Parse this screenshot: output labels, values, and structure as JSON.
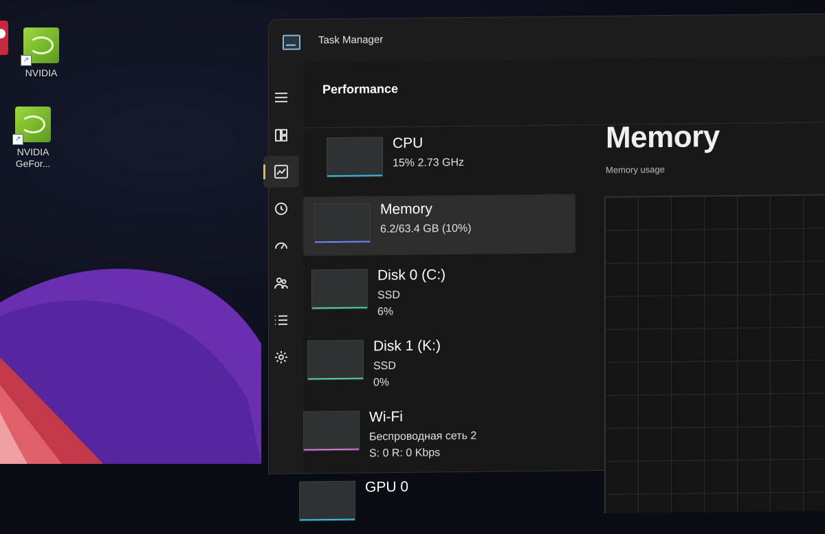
{
  "desktop": {
    "icons": [
      {
        "label": "NVIDIA"
      },
      {
        "label": "NVIDIA GeFor..."
      }
    ]
  },
  "window": {
    "title": "Task Manager",
    "page_title": "Performance",
    "active_nav": "performance"
  },
  "nav": [
    {
      "name": "hamburger-menu-icon"
    },
    {
      "name": "processes-icon"
    },
    {
      "name": "performance-icon"
    },
    {
      "name": "app-history-icon"
    },
    {
      "name": "startup-apps-icon"
    },
    {
      "name": "users-icon"
    },
    {
      "name": "details-icon"
    },
    {
      "name": "services-icon"
    }
  ],
  "performance": {
    "items": [
      {
        "name": "CPU",
        "sub": "15%  2.73 GHz",
        "sub2": "",
        "line_color": "#3db8e0",
        "selected": false
      },
      {
        "name": "Memory",
        "sub": "6.2/63.4 GB (10%)",
        "sub2": "",
        "line_color": "#7a7fff",
        "selected": true
      },
      {
        "name": "Disk 0 (C:)",
        "sub": "SSD",
        "sub2": "6%",
        "line_color": "#4fd0a0",
        "selected": false
      },
      {
        "name": "Disk 1 (K:)",
        "sub": "SSD",
        "sub2": "0%",
        "line_color": "#4fd0a0",
        "selected": false
      },
      {
        "name": "Wi-Fi",
        "sub": "Беспроводная сеть 2",
        "sub2": "S: 0  R: 0 Kbps",
        "line_color": "#d27ad6",
        "selected": false
      },
      {
        "name": "GPU 0",
        "sub": "",
        "sub2": "",
        "line_color": "#3db8e0",
        "selected": false
      }
    ]
  },
  "detail": {
    "title": "Memory",
    "subtitle": "Memory usage"
  }
}
